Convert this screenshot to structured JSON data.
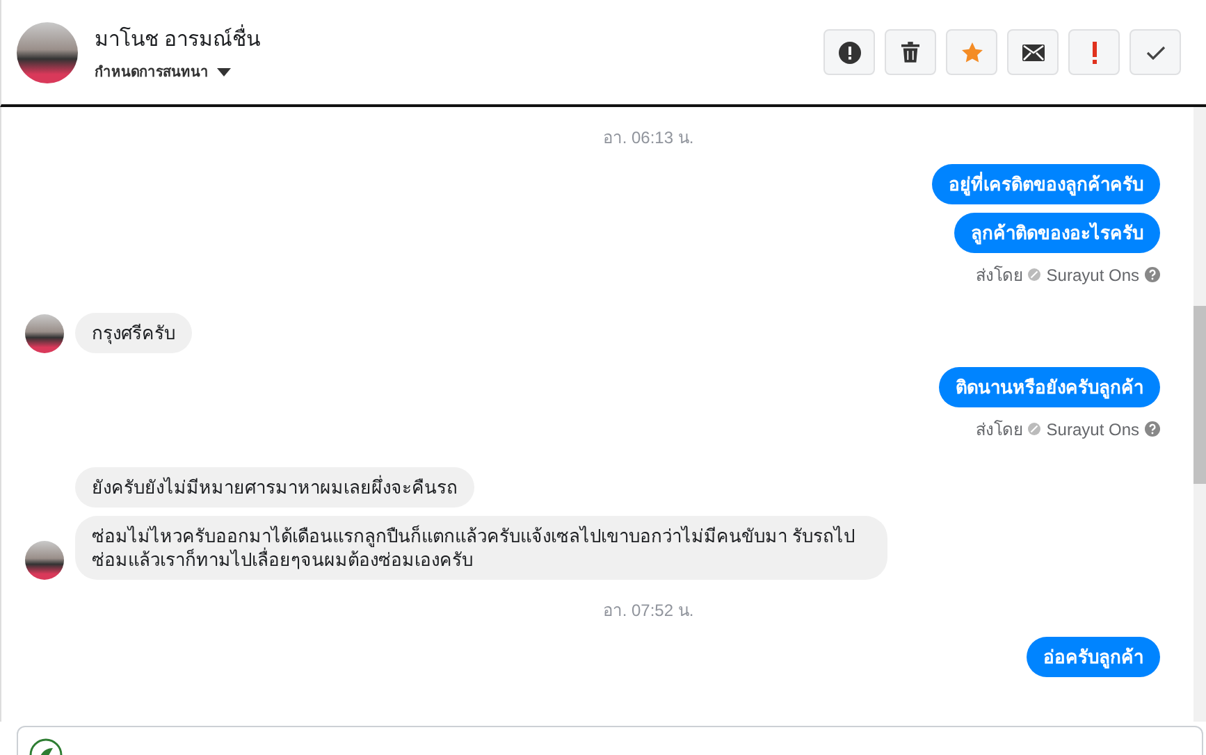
{
  "header": {
    "name": "มาโนช อารมณ์ชื่น",
    "subtitle": "กำหนดการสนทนา"
  },
  "actions": [
    {
      "kind": "alert"
    },
    {
      "kind": "trash"
    },
    {
      "kind": "star"
    },
    {
      "kind": "mail"
    },
    {
      "kind": "important"
    },
    {
      "kind": "done"
    }
  ],
  "messages": [
    {
      "kind": "time",
      "text": "อา. 06:13 น."
    },
    {
      "kind": "out",
      "bubbles": [
        "อยู่ที่เครดิตของลูกค้าครับ",
        "ลูกค้าติดของอะไรครับ"
      ],
      "sent_by": "ส่งโดย",
      "sender": "Surayut Ons"
    },
    {
      "kind": "in",
      "bubbles": [
        "กรุงศรีครับ"
      ]
    },
    {
      "kind": "out",
      "bubbles": [
        "ติดนานหรือยังครับลูกค้า"
      ],
      "sent_by": "ส่งโดย",
      "sender": "Surayut Ons"
    },
    {
      "kind": "in",
      "bubbles": [
        "ยังครับยังไม่มีหมายศารมาหาผมเลยผึ่งจะคืนรถ",
        "ซ่อมไม่ไหวครับออกมาได้เดือนแรกลูกปืนก็แตกแล้วครับแจ้งเซลไปเขาบอกว่าไม่มีคนขับมา รับรถไปซ่อมแล้วเราก็ทามไปเลื่อยๆจนผมต้องซ่อมเองครับ"
      ]
    },
    {
      "kind": "time",
      "text": "อา. 07:52 น."
    },
    {
      "kind": "out",
      "bubbles": [
        "อ่อครับลูกค้า"
      ]
    }
  ]
}
